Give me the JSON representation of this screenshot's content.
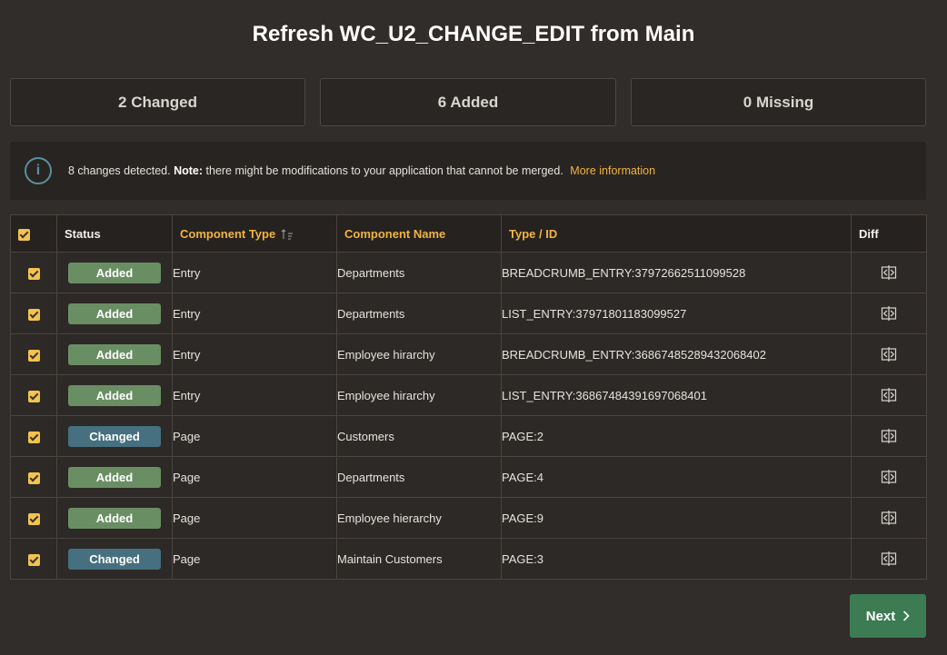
{
  "title": "Refresh WC_U2_CHANGE_EDIT from Main",
  "summary": {
    "changed": "2 Changed",
    "added": "6 Added",
    "missing": "0 Missing"
  },
  "info": {
    "text_pre": "8 changes detected.",
    "note_label": "Note:",
    "text_post": "there might be modifications to your application that cannot be merged.",
    "link": "More information"
  },
  "table": {
    "headers": {
      "status": "Status",
      "component_type": "Component Type",
      "component_name": "Component Name",
      "type_id": "Type / ID",
      "diff": "Diff"
    },
    "rows": [
      {
        "status": "Added",
        "type": "Entry",
        "name": "Departments",
        "type_id": "BREADCRUMB_ENTRY:37972662511099528"
      },
      {
        "status": "Added",
        "type": "Entry",
        "name": "Departments",
        "type_id": "LIST_ENTRY:37971801183099527"
      },
      {
        "status": "Added",
        "type": "Entry",
        "name": "Employee hirarchy",
        "type_id": "BREADCRUMB_ENTRY:36867485289432068402"
      },
      {
        "status": "Added",
        "type": "Entry",
        "name": "Employee hirarchy",
        "type_id": "LIST_ENTRY:36867484391697068401"
      },
      {
        "status": "Changed",
        "type": "Page",
        "name": "Customers",
        "type_id": "PAGE:2"
      },
      {
        "status": "Added",
        "type": "Page",
        "name": "Departments",
        "type_id": "PAGE:4"
      },
      {
        "status": "Added",
        "type": "Page",
        "name": "Employee hierarchy",
        "type_id": "PAGE:9"
      },
      {
        "status": "Changed",
        "type": "Page",
        "name": "Maintain Customers",
        "type_id": "PAGE:3"
      }
    ]
  },
  "colors": {
    "added_badge": "#6a8e64",
    "changed_badge": "#46707f",
    "accent": "#f0b441",
    "next_button": "#3d7b53"
  },
  "next_label": "Next"
}
